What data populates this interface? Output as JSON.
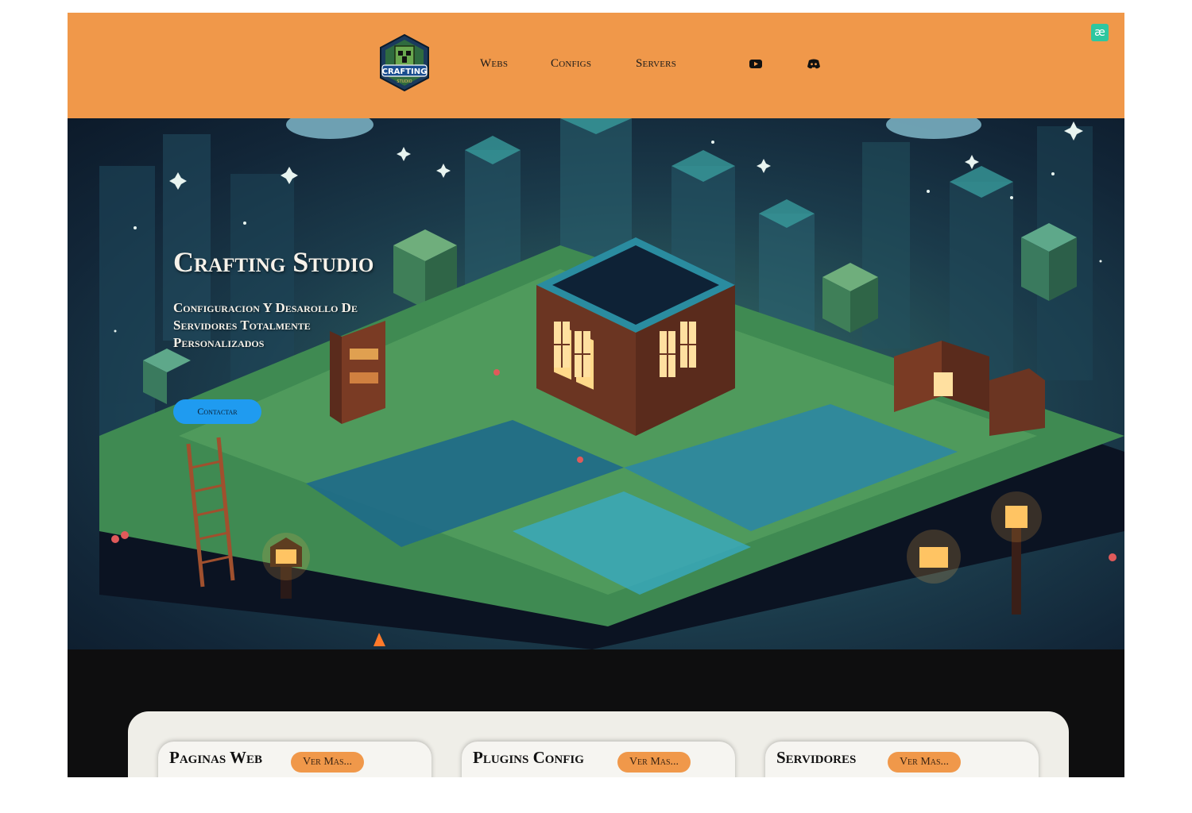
{
  "colors": {
    "header_bg": "#f0984a",
    "accent_blue": "#1f9bf0",
    "section_bg": "#0e0e0f",
    "panel_bg": "#efeee8",
    "badge_green": "#2ec7a0"
  },
  "header": {
    "logo_text": "CRAFTING",
    "logo_subtext": "STUDIO",
    "nav": [
      {
        "label": "Webs"
      },
      {
        "label": "Configs"
      },
      {
        "label": "Servers"
      }
    ],
    "social": [
      {
        "icon": "youtube-icon"
      },
      {
        "icon": "discord-icon"
      }
    ],
    "extension_badge": "æ"
  },
  "hero": {
    "title": "Crafting Studio",
    "subtitle": "Configuracion Y Desarollo De Servidores Totalmente Personalizados",
    "cta_label": "Contactar"
  },
  "services": [
    {
      "title": "Paginas Web",
      "button": "Ver Mas..."
    },
    {
      "title": "Plugins Config",
      "button": "Ver Mas..."
    },
    {
      "title": "Servidores",
      "button": "Ver Mas..."
    }
  ]
}
